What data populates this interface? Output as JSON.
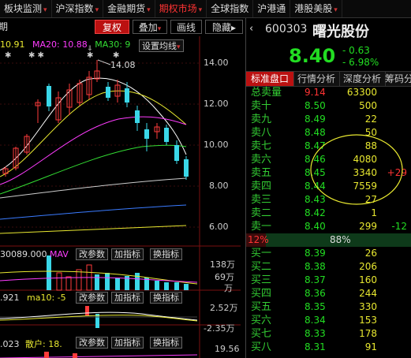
{
  "topnav": {
    "items": [
      {
        "label": "板块监测",
        "arrow": "▾",
        "active": false
      },
      {
        "label": "沪深指数",
        "arrow": "▾",
        "active": false
      },
      {
        "label": "金融期货",
        "arrow": "▾",
        "active": false
      },
      {
        "label": "期权市场",
        "arrow": "▾",
        "active": true
      },
      {
        "label": "全球指数",
        "arrow": "",
        "active": false
      },
      {
        "label": "沪港通",
        "arrow": "",
        "active": false
      },
      {
        "label": "港股美股",
        "arrow": "▾",
        "active": false
      }
    ]
  },
  "toolbar": {
    "period_label": "期",
    "fuquan": "复权",
    "overlay": "叠加",
    "draw_line": "画线",
    "hide": "隐藏",
    "hide_arrow": "▸"
  },
  "ma_legend": {
    "ma10": "10.91",
    "ma20": "MA20: 10.88",
    "ma30": "MA30: 9",
    "set_ma": "设置均线"
  },
  "price_chart": {
    "y_ticks": [
      "14.00",
      "12.00",
      "10.00",
      "8.00",
      "6.00"
    ],
    "high_label": "14.08",
    "colors": {
      "up": "#ff3b3b",
      "down": "#3ad7e8",
      "ma5": "#ffffff",
      "ma10": "#e8e830",
      "ma20": "#ff3cff",
      "ma30": "#33dd33"
    }
  },
  "volume_panel": {
    "legend": "30089.000",
    "ma_label": "MAV",
    "btn_params": "改参数",
    "btn_add": "加指标",
    "btn_switch": "换指标",
    "y_ticks": [
      "138万",
      "69万",
      "万"
    ]
  },
  "macd_panel": {
    "legend_a": ".921",
    "legend_b": "ma10: -5",
    "btn_params": "改参数",
    "btn_add": "加指标",
    "btn_switch": "换指标",
    "y_ticks": [
      "2.52万",
      "-2.35万"
    ]
  },
  "retail_panel": {
    "legend_a": ".023",
    "legend_b": "散户: 18.",
    "btn_params": "改参数",
    "btn_add": "加指标",
    "btn_switch": "换指标",
    "y_tick": "19.56"
  },
  "quote": {
    "code": "600303",
    "name": "曙光股份",
    "price": "8.40",
    "change": "- 0.63",
    "change_pct": "- 6.98%",
    "colors": {
      "down": "#22dd22",
      "up": "#ff3333",
      "flat": "#eeeeee",
      "label": "#33cc33"
    }
  },
  "tabs": [
    "标准盘口",
    "行情分析",
    "深度分析",
    "筹码分"
  ],
  "orderbook": {
    "total_sell": {
      "label": "总卖量",
      "price": "9.14",
      "volume": "63300"
    },
    "asks": [
      {
        "label": "卖十",
        "price": "8.50",
        "volume": "500",
        "delta": ""
      },
      {
        "label": "卖九",
        "price": "8.49",
        "volume": "22",
        "delta": ""
      },
      {
        "label": "卖八",
        "price": "8.48",
        "volume": "50",
        "delta": ""
      },
      {
        "label": "卖七",
        "price": "8.47",
        "volume": "88",
        "delta": ""
      },
      {
        "label": "卖六",
        "price": "8.46",
        "volume": "4080",
        "delta": ""
      },
      {
        "label": "卖五",
        "price": "8.45",
        "volume": "3340",
        "delta": "+29"
      },
      {
        "label": "卖四",
        "price": "8.44",
        "volume": "7559",
        "delta": ""
      },
      {
        "label": "卖三",
        "price": "8.43",
        "volume": "27",
        "delta": ""
      },
      {
        "label": "卖二",
        "price": "8.42",
        "volume": "1",
        "delta": ""
      },
      {
        "label": "卖一",
        "price": "8.40",
        "volume": "299",
        "delta": "-12"
      }
    ],
    "ratio": {
      "left": "12%",
      "right": "88%"
    },
    "bids": [
      {
        "label": "买一",
        "price": "8.39",
        "volume": "26"
      },
      {
        "label": "买二",
        "price": "8.38",
        "volume": "206"
      },
      {
        "label": "买三",
        "price": "8.37",
        "volume": "160"
      },
      {
        "label": "买四",
        "price": "8.36",
        "volume": "244"
      },
      {
        "label": "买五",
        "price": "8.35",
        "volume": "330"
      },
      {
        "label": "买六",
        "price": "8.34",
        "volume": "153"
      },
      {
        "label": "买七",
        "price": "8.33",
        "volume": "178"
      },
      {
        "label": "买八",
        "price": "8.31",
        "volume": "91"
      }
    ]
  }
}
